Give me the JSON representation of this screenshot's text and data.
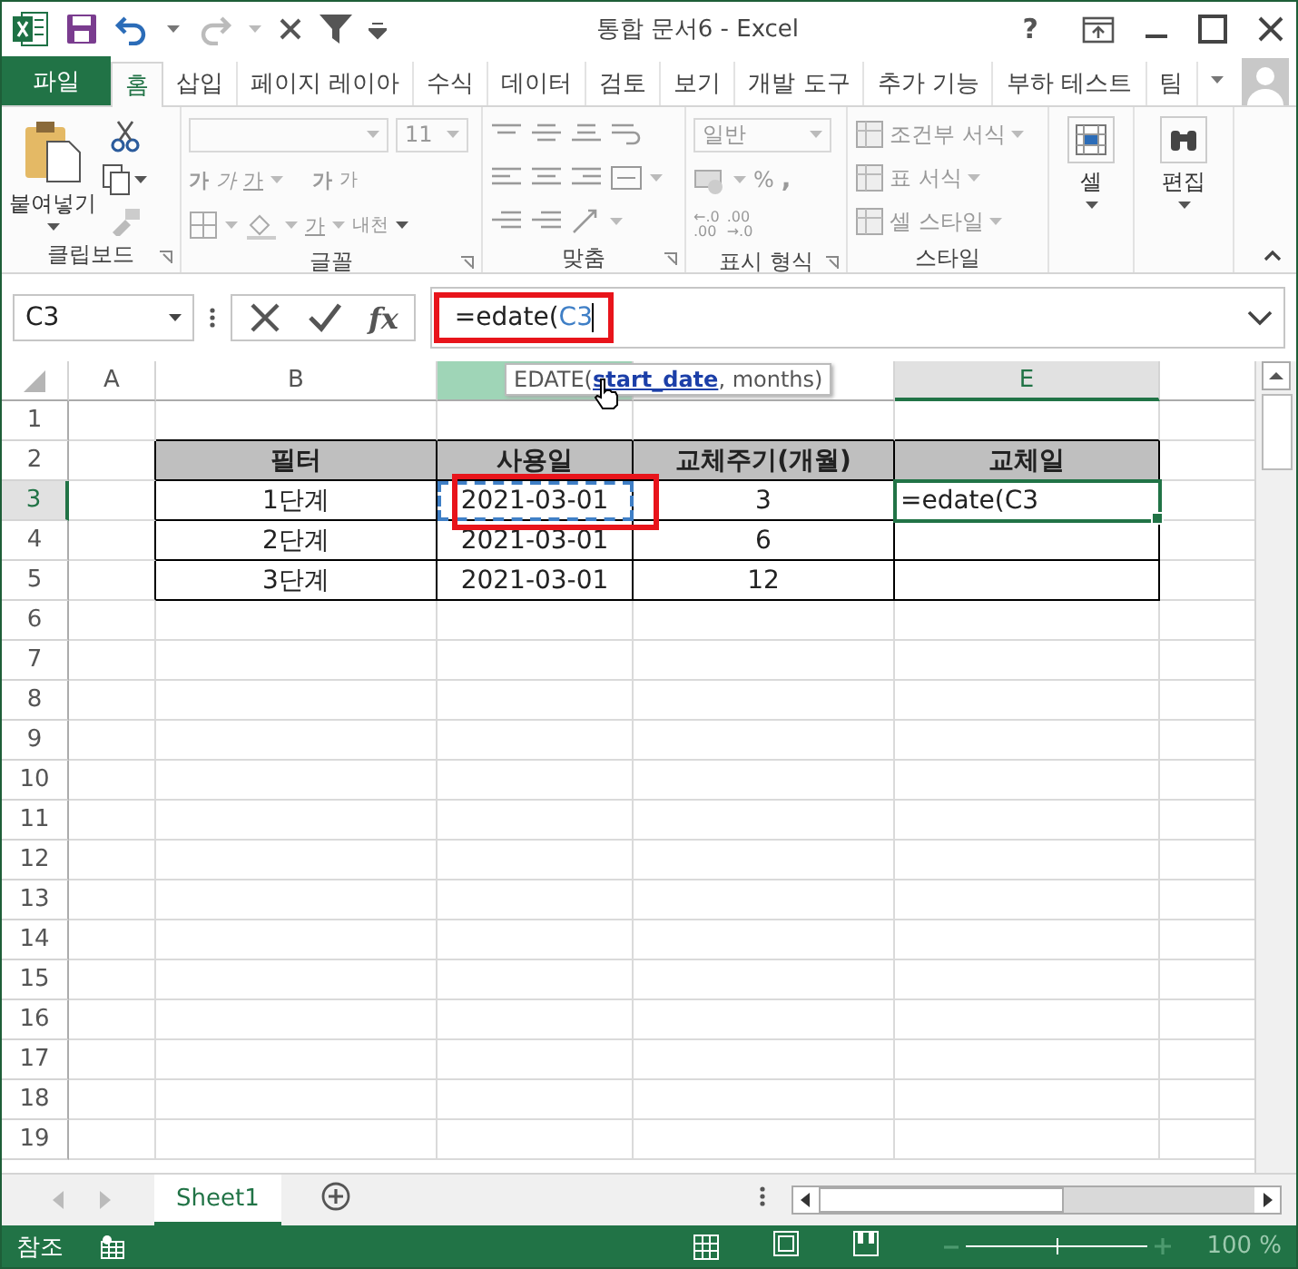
{
  "window": {
    "title": "통합 문서6 - Excel",
    "help": "?"
  },
  "ribbon_tabs": [
    {
      "label": "파일",
      "kind": "file",
      "selected": false
    },
    {
      "label": "홈",
      "kind": "tab",
      "selected": true
    },
    {
      "label": "삽입",
      "kind": "tab",
      "selected": false
    },
    {
      "label": "페이지 레이아",
      "kind": "tab",
      "selected": false
    },
    {
      "label": "수식",
      "kind": "tab",
      "selected": false
    },
    {
      "label": "데이터",
      "kind": "tab",
      "selected": false
    },
    {
      "label": "검토",
      "kind": "tab",
      "selected": false
    },
    {
      "label": "보기",
      "kind": "tab",
      "selected": false
    },
    {
      "label": "개발 도구",
      "kind": "tab",
      "selected": false
    },
    {
      "label": "추가 기능",
      "kind": "tab",
      "selected": false
    },
    {
      "label": "부하 테스트",
      "kind": "tab",
      "selected": false
    },
    {
      "label": "팀",
      "kind": "tab",
      "selected": false
    }
  ],
  "ribbon": {
    "clipboard": {
      "label": "클립보드",
      "paste": "붙여넣기"
    },
    "font": {
      "label": "글꼴",
      "size": "11",
      "bold": "가",
      "italic": "가",
      "underline": "가",
      "grow": "가",
      "shrink": "가",
      "font_color": "가",
      "phonetic": "내천"
    },
    "alignment": {
      "label": "맞춤"
    },
    "number": {
      "label": "표시 형식",
      "format": "일반",
      "percent": "%",
      "comma": ",",
      "decimal_buttons": [
        {
          "top": "←.0",
          "bottom": ".00"
        },
        {
          "top": ".00",
          "bottom": "→.0"
        }
      ]
    },
    "styles": {
      "label": "스타일",
      "items": [
        "조건부 서식",
        "표 서식",
        "셀 스타일"
      ]
    },
    "cells": {
      "label": "셀"
    },
    "editing": {
      "label": "편집"
    }
  },
  "formula_bar": {
    "name_box": "C3",
    "function_button": "fx",
    "formula": "=edate(",
    "reference": "C3",
    "highlighted": true
  },
  "tooltip": "EDATE(**start_date**, months)",
  "sheet": {
    "columns": [
      {
        "label": "A",
        "selected": false,
        "referenced": false
      },
      {
        "label": "B",
        "selected": false,
        "referenced": false
      },
      {
        "selected": false,
        "referenced": true
      },
      {
        "selected": false,
        "referenced": false
      },
      {
        "label": "E",
        "selected": true,
        "referenced": false
      }
    ],
    "rows": [
      {
        "label": "1",
        "selected": false
      },
      {
        "label": "2",
        "selected": false,
        "cells": [
          {
            "kind": "blank"
          },
          {
            "kind": "header",
            "text": "필터",
            "active": false,
            "referenced": false,
            "highlighted": false
          },
          {
            "kind": "header",
            "text": "사용일",
            "active": false,
            "referenced": false,
            "highlighted": false
          },
          {
            "kind": "header",
            "text": "교체주기(개월)",
            "active": false,
            "referenced": false,
            "highlighted": false
          },
          {
            "kind": "header",
            "text": "교체일",
            "active": false,
            "referenced": false,
            "highlighted": false
          }
        ]
      },
      {
        "label": "3",
        "selected": true,
        "cells": [
          {
            "kind": "blank"
          },
          {
            "kind": "data",
            "text": "1단계",
            "active": false,
            "referenced": false,
            "highlighted": false
          },
          {
            "kind": "data",
            "text": "2021-03-01",
            "active": false,
            "referenced": true,
            "highlighted": true
          },
          {
            "kind": "data",
            "text": "3",
            "active": false,
            "referenced": false,
            "highlighted": false
          },
          {
            "kind": "formula",
            "text": "=edate(C3",
            "active": true,
            "referenced": false,
            "highlighted": false
          }
        ]
      },
      {
        "label": "4",
        "selected": false,
        "cells": [
          {
            "kind": "blank"
          },
          {
            "kind": "data",
            "text": "2단계",
            "active": false,
            "referenced": false,
            "highlighted": false
          },
          {
            "kind": "data",
            "text": "2021-03-01",
            "active": false,
            "referenced": false,
            "highlighted": false
          },
          {
            "kind": "data",
            "text": "6",
            "active": false,
            "referenced": false,
            "highlighted": false
          },
          {
            "kind": "data",
            "active": false,
            "referenced": false,
            "highlighted": false
          }
        ]
      },
      {
        "label": "5",
        "selected": false,
        "cells": [
          {
            "kind": "blank"
          },
          {
            "kind": "data",
            "text": "3단계",
            "active": false,
            "referenced": false,
            "highlighted": false
          },
          {
            "kind": "data",
            "text": "2021-03-01",
            "active": false,
            "referenced": false,
            "highlighted": false
          },
          {
            "kind": "data",
            "text": "12",
            "active": false,
            "referenced": false,
            "highlighted": false
          },
          {
            "kind": "data",
            "active": false,
            "referenced": false,
            "highlighted": false
          }
        ]
      },
      {
        "label": "6",
        "selected": false
      },
      {
        "label": "7",
        "selected": false
      },
      {
        "label": "8",
        "selected": false
      },
      {
        "label": "9",
        "selected": false
      },
      {
        "label": "10",
        "selected": false
      },
      {
        "label": "11",
        "selected": false
      },
      {
        "label": "12",
        "selected": false
      },
      {
        "label": "13",
        "selected": false
      },
      {
        "label": "14",
        "selected": false
      },
      {
        "label": "15",
        "selected": false
      },
      {
        "label": "16",
        "selected": false
      },
      {
        "label": "17",
        "selected": false
      },
      {
        "label": "18",
        "selected": false
      },
      {
        "label": "19",
        "selected": false
      }
    ]
  },
  "sheet_tabs": [
    {
      "label": "Sheet1",
      "selected": true
    }
  ],
  "status_bar": {
    "mode": "참조",
    "zoom": "100 %",
    "zoom_slider": {
      "level": 0.5
    }
  }
}
